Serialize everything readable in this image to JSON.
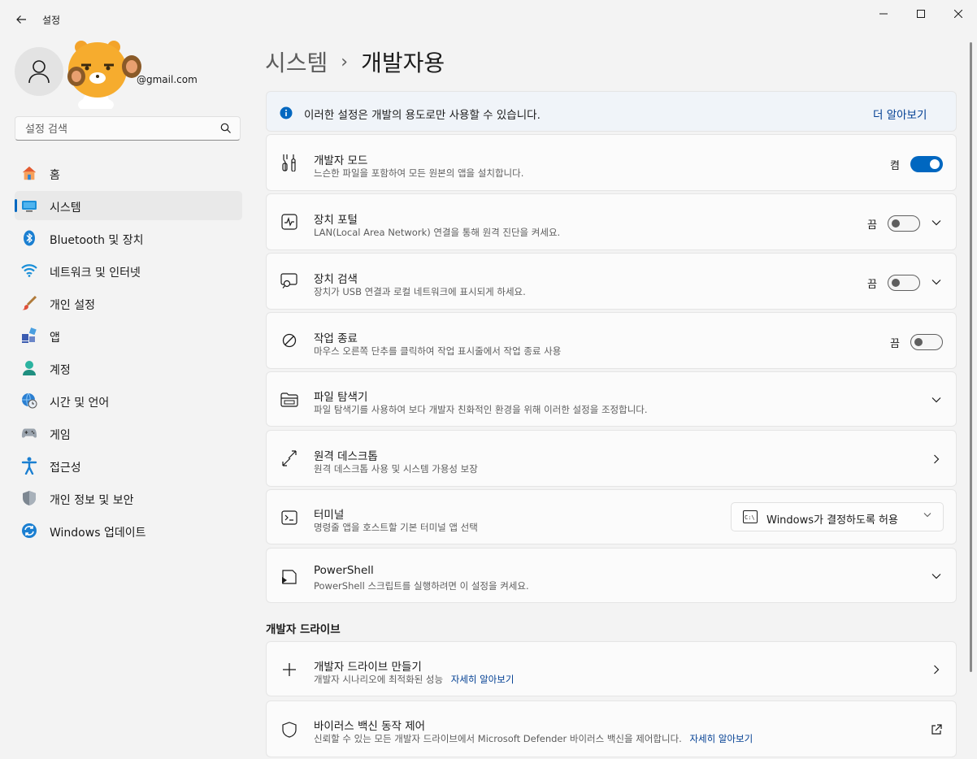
{
  "app": {
    "title": "설정"
  },
  "profile": {
    "email": "@gmail.com"
  },
  "search": {
    "placeholder": "설정 검색"
  },
  "nav": [
    {
      "label": "홈",
      "icon": "home-icon"
    },
    {
      "label": "시스템",
      "icon": "system-icon",
      "active": true
    },
    {
      "label": "Bluetooth 및 장치",
      "icon": "bluetooth-icon"
    },
    {
      "label": "네트워크 및 인터넷",
      "icon": "wifi-icon"
    },
    {
      "label": "개인 설정",
      "icon": "brush-icon"
    },
    {
      "label": "앱",
      "icon": "apps-icon"
    },
    {
      "label": "계정",
      "icon": "account-icon"
    },
    {
      "label": "시간 및 언어",
      "icon": "globe-clock-icon"
    },
    {
      "label": "게임",
      "icon": "gamepad-icon"
    },
    {
      "label": "접근성",
      "icon": "accessibility-icon"
    },
    {
      "label": "개인 정보 및 보안",
      "icon": "shield-icon"
    },
    {
      "label": "Windows 업데이트",
      "icon": "update-icon"
    }
  ],
  "breadcrumb": {
    "parent": "시스템",
    "separator": "›",
    "current": "개발자용"
  },
  "info": {
    "text": "이러한 설정은 개발의 용도로만 사용할 수 있습니다.",
    "link": "더 알아보기"
  },
  "settings": {
    "dev_mode": {
      "title": "개발자 모드",
      "desc": "느슨한 파일을 포함하여 모든 원본의 앱을 설치합니다.",
      "state": "켬",
      "on": true
    },
    "device_portal": {
      "title": "장치 포털",
      "desc": "LAN(Local Area Network) 연결을 통해 원격 진단을 켜세요.",
      "state": "끔",
      "on": false
    },
    "device_discovery": {
      "title": "장치 검색",
      "desc": "장치가 USB 연결과 로컬 네트워크에 표시되게 하세요.",
      "state": "끔",
      "on": false
    },
    "end_task": {
      "title": "작업 종료",
      "desc": "마우스 오른쪽 단추를 클릭하여 작업 표시줄에서 작업 종료 사용",
      "state": "끔",
      "on": false
    },
    "file_explorer": {
      "title": "파일 탐색기",
      "desc": "파일 탐색기를 사용하여 보다 개발자 친화적인 환경을 위해 이러한 설정을 조정합니다."
    },
    "remote_desktop": {
      "title": "원격 데스크톱",
      "desc": "원격 데스크톱 사용 및 시스템 가용성 보장"
    },
    "terminal": {
      "title": "터미널",
      "desc": "명령줄 앱을 호스트할 기본 터미널 앱 선택",
      "selected": "Windows가 결정하도록 허용"
    },
    "powershell": {
      "title": "PowerShell",
      "desc": "PowerShell 스크립트를 실행하려면 이 설정을 켜세요."
    }
  },
  "dev_drive": {
    "section_title": "개발자 드라이브",
    "create": {
      "title": "개발자 드라이브 만들기",
      "desc": "개발자 시나리오에 최적화된 성능",
      "link": "자세히 알아보기"
    },
    "antivirus": {
      "title": "바이러스 백신 동작 제어",
      "desc": "신뢰할 수 있는 모든 개발자 드라이브에서 Microsoft Defender 바이러스 백신을 제어합니다.",
      "link": "자세히 알아보기"
    }
  },
  "colors": {
    "accent": "#0067c0",
    "link": "#003e92"
  }
}
